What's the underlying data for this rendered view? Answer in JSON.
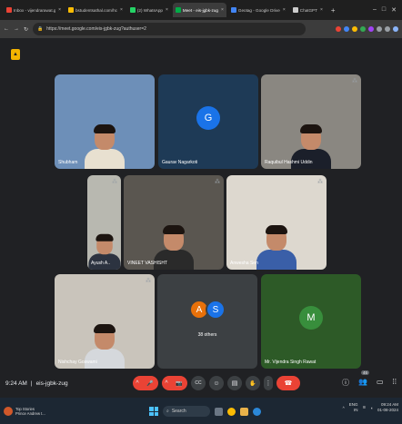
{
  "browser": {
    "tabs": [
      {
        "label": "Inbox - vijendrarawat.gp@",
        "color": "#ea4335",
        "active": false
      },
      {
        "label": "bstudentsathal.com/hc",
        "color": "#fbbc04",
        "active": false
      },
      {
        "label": "(2) WhatsApp",
        "color": "#25d366",
        "active": false
      },
      {
        "label": "Meet - eis-jgbk-zug",
        "color": "#00ac47",
        "active": true
      },
      {
        "label": "Geotag - Google Drive",
        "color": "#4285f4",
        "active": false
      },
      {
        "label": "ChatGPT",
        "color": "#cccccc",
        "active": false
      }
    ],
    "new_tab": "+",
    "url": "https://meet.google.com/eis-jgbk-zug?authuser=2"
  },
  "participants": [
    {
      "name": "Shubham",
      "kind": "video",
      "bg": "#6d8fb8",
      "shirt": "#e8e0d0",
      "muted": false
    },
    {
      "name": "Gaurav Nagarkoti",
      "kind": "avatar",
      "initial": "G",
      "bg": "#1e3a56",
      "avatar_color": "#1a73e8",
      "muted": false
    },
    {
      "name": "Raquibul Hashmi Uddin",
      "kind": "video",
      "bg": "#8a8781",
      "shirt": "#1b1f2a",
      "muted": true
    },
    {
      "name": "Ayush A..",
      "kind": "video",
      "bg": "#b8b8b0",
      "shirt": "#2c3340",
      "muted": true
    },
    {
      "name": "VINEET VASHISHT",
      "kind": "video",
      "bg": "#5a5650",
      "shirt": "#2a2a2a",
      "muted": true
    },
    {
      "name": "Anwesha Sen",
      "kind": "video",
      "bg": "#ddd8cf",
      "shirt": "#3a5fa8",
      "muted": true
    },
    {
      "name": "Nishchay Goswami",
      "kind": "video",
      "bg": "#c9c4bb",
      "shirt": "#d5d8dc",
      "muted": true
    },
    {
      "name": "38 others",
      "kind": "others",
      "initials": [
        "A",
        "S"
      ],
      "colors": [
        "#e8710a",
        "#1a73e8"
      ]
    },
    {
      "name": "Mr. Vijendra Singh Rawat",
      "kind": "avatar",
      "initial": "M",
      "bg": "#2d5a27",
      "avatar_color": "#388e3c",
      "muted": false
    }
  ],
  "meeting": {
    "time": "9:24 AM",
    "separator": "|",
    "code": "eis-jgbk-zug",
    "people_badge": "46"
  },
  "controls": {
    "mic": "🎤",
    "camera": "📷",
    "captions": "CC",
    "emoji": "☺",
    "present": "▤",
    "raise_hand": "✋",
    "more": "⋮",
    "leave": "☎"
  },
  "taskbar": {
    "news_title": "Top Stories",
    "news_sub": "Prince Andrew t...",
    "search": "Search",
    "language": "ENG",
    "lang_region": "IN",
    "time": "09:24 AM",
    "date": "01-08-2024"
  }
}
